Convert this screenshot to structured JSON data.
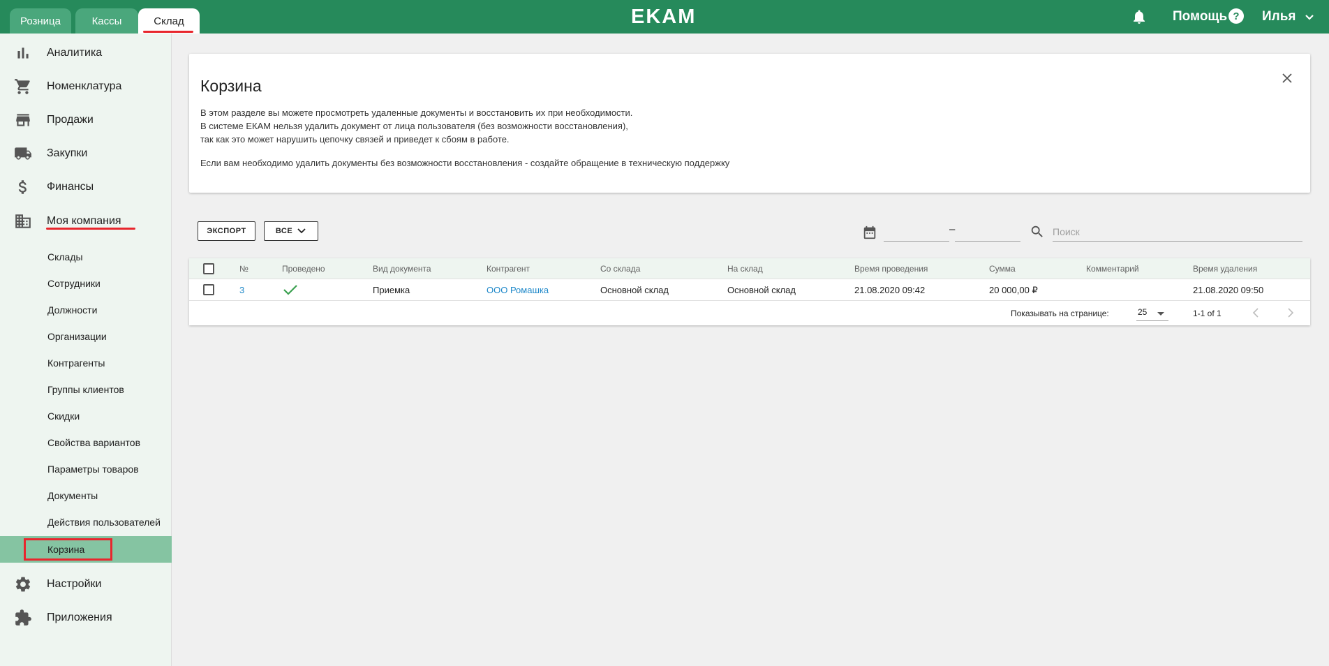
{
  "topbar": {
    "tabs": [
      {
        "label": "Розница"
      },
      {
        "label": "Кассы"
      },
      {
        "label": "Склад"
      }
    ],
    "logo": "EKAM",
    "help_label": "Помощь",
    "help_icon": "?",
    "user_name": "Илья",
    "colors": {
      "brand": "#268a5b",
      "tab_inactive": "#4aa77c",
      "highlight": "#e8262d"
    }
  },
  "sidebar": {
    "items": [
      {
        "label": "Аналитика",
        "icon": "bar-chart-icon"
      },
      {
        "label": "Номенклатура",
        "icon": "cart-icon"
      },
      {
        "label": "Продажи",
        "icon": "store-icon"
      },
      {
        "label": "Закупки",
        "icon": "truck-icon"
      },
      {
        "label": "Финансы",
        "icon": "dollar-icon"
      },
      {
        "label": "Моя компания",
        "icon": "building-icon"
      }
    ],
    "subitems": [
      {
        "label": "Склады"
      },
      {
        "label": "Сотрудники"
      },
      {
        "label": "Должности"
      },
      {
        "label": "Организации"
      },
      {
        "label": "Контрагенты"
      },
      {
        "label": "Группы клиентов"
      },
      {
        "label": "Скидки"
      },
      {
        "label": "Свойства вариантов"
      },
      {
        "label": "Параметры товаров"
      },
      {
        "label": "Документы"
      },
      {
        "label": "Действия пользователей"
      },
      {
        "label": "Корзина"
      }
    ],
    "bottom_items": [
      {
        "label": "Настройки",
        "icon": "gear-icon"
      },
      {
        "label": "Приложения",
        "icon": "puzzle-icon"
      }
    ],
    "active_subitem": "Корзина"
  },
  "info": {
    "title": "Корзина",
    "lines": [
      "В этом разделе вы можете просмотреть удаленные документы и восстановить их при необходимости.",
      "В системе ЕКАМ нельзя удалить документ от лица пользователя (без возможности восстановления),",
      "так как это может нарушить цепочку связей и приведет к сбоям в работе.",
      "Если вам необходимо удалить документы без возможности восстановления - создайте обращение в техническую поддержку"
    ]
  },
  "toolbar": {
    "export_label": "ЭКСПОРТ",
    "filter_label": "ВСЕ",
    "date_from": "",
    "date_to": "",
    "date_dash": "–",
    "search_placeholder": "Поиск"
  },
  "table": {
    "columns": [
      "№",
      "Проведено",
      "Вид документа",
      "Контрагент",
      "Со склада",
      "На склад",
      "Время проведения",
      "Сумма",
      "Комментарий",
      "Время удаления"
    ],
    "rows": [
      {
        "number": "3",
        "posted": true,
        "doc_type": "Приемка",
        "counterparty": "ООО Ромашка",
        "from_store": "Основной склад",
        "to_store": "Основной склад",
        "posted_time": "21.08.2020 09:42",
        "sum": "20 000,00 ₽",
        "comment": "",
        "deleted_time": "21.08.2020 09:50"
      }
    ],
    "footer": {
      "per_page_label": "Показывать на странице:",
      "per_page_value": "25",
      "range": "1-1 of 1"
    }
  }
}
